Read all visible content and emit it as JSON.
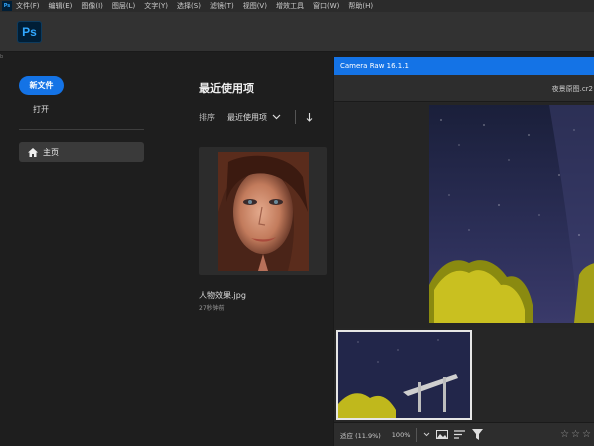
{
  "menubar": {
    "app_badge": "Ps",
    "items": [
      "文件(F)",
      "编辑(E)",
      "图像(I)",
      "图层(L)",
      "文字(Y)",
      "选择(S)",
      "滤镜(T)",
      "视图(V)",
      "增效工具",
      "窗口(W)",
      "帮助(H)"
    ]
  },
  "logo": {
    "text": "Ps"
  },
  "sidebar": {
    "new_file": "新文件",
    "open": "打开",
    "home": "主页"
  },
  "recent": {
    "title": "最近使用项",
    "sort_label": "排序",
    "sort_value": "最近使用项",
    "files": [
      {
        "name": "人物效果.jpg",
        "time": "27秒钟前"
      }
    ]
  },
  "camera_raw": {
    "title": "Camera Raw 16.1.1",
    "filename": "夜景原图.cr2",
    "fit_label": "适应 (11.9%)",
    "zoom": "100%",
    "stars": "☆☆☆"
  },
  "colors": {
    "accent": "#1473e6",
    "background": "#1e1e1e",
    "ps_dark": "#001e36",
    "ps_blue": "#31a8ff"
  },
  "edge_label": "b"
}
